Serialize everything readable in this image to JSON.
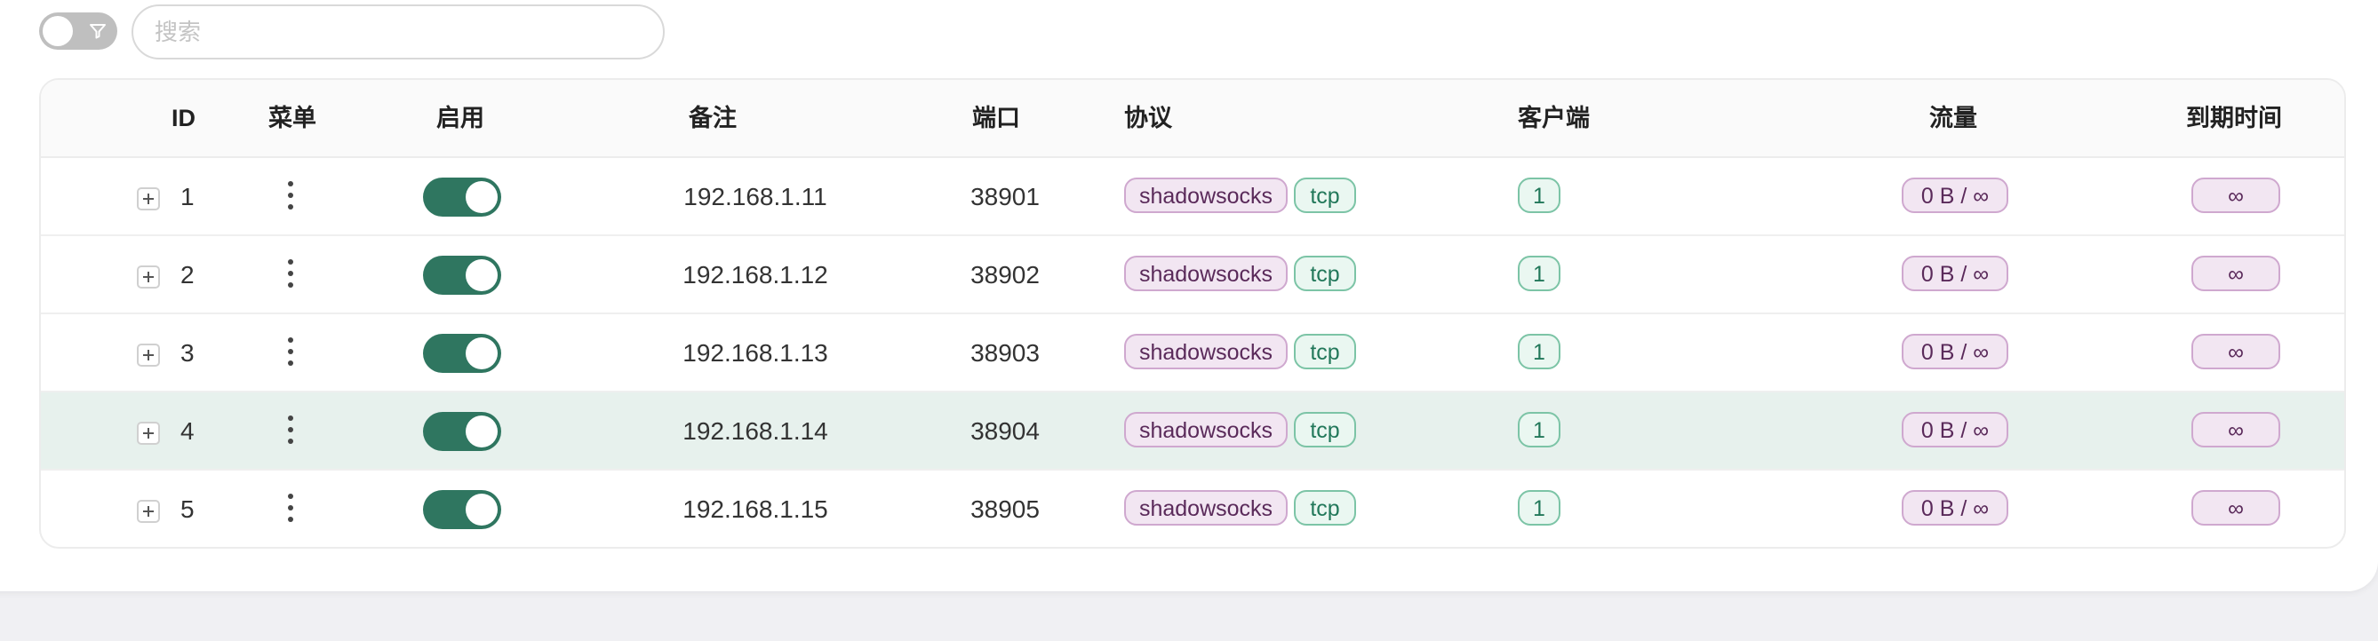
{
  "toolbar": {
    "filter_toggle_on": false,
    "search_placeholder": "搜索",
    "search_value": ""
  },
  "table": {
    "headers": {
      "id": "ID",
      "menu": "菜单",
      "enable": "启用",
      "remark": "备注",
      "port": "端口",
      "protocol": "协议",
      "clients": "客户端",
      "traffic": "流量",
      "expiry": "到期时间"
    },
    "rows": [
      {
        "id": "1",
        "enabled": true,
        "remark": "192.168.1.11",
        "port": "38901",
        "protocol": "shadowsocks",
        "network": "tcp",
        "clients": "1",
        "traffic": "0 B / ∞",
        "expiry": "∞"
      },
      {
        "id": "2",
        "enabled": true,
        "remark": "192.168.1.12",
        "port": "38902",
        "protocol": "shadowsocks",
        "network": "tcp",
        "clients": "1",
        "traffic": "0 B / ∞",
        "expiry": "∞"
      },
      {
        "id": "3",
        "enabled": true,
        "remark": "192.168.1.13",
        "port": "38903",
        "protocol": "shadowsocks",
        "network": "tcp",
        "clients": "1",
        "traffic": "0 B / ∞",
        "expiry": "∞"
      },
      {
        "id": "4",
        "enabled": true,
        "remark": "192.168.1.14",
        "port": "38904",
        "protocol": "shadowsocks",
        "network": "tcp",
        "clients": "1",
        "traffic": "0 B / ∞",
        "expiry": "∞"
      },
      {
        "id": "5",
        "enabled": true,
        "remark": "192.168.1.15",
        "port": "38905",
        "protocol": "shadowsocks",
        "network": "tcp",
        "clients": "1",
        "traffic": "0 B / ∞",
        "expiry": "∞"
      }
    ]
  },
  "colors": {
    "switch_on": "#2f7660",
    "switch_off": "#bfbfbf",
    "highlight_row": "#e7f1ed",
    "tag_purple_bg": "#f2e6f2",
    "tag_green_bg": "#eaf7f1"
  }
}
